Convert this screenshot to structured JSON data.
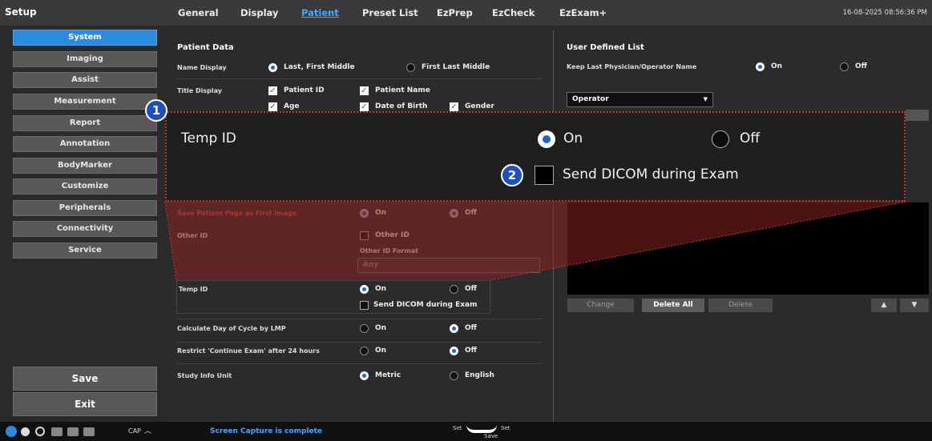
{
  "app": {
    "title": "Setup",
    "datetime": "16-08-2025 08:56:36 PM"
  },
  "tabs": [
    {
      "label": "General"
    },
    {
      "label": "Display"
    },
    {
      "label": "Patient"
    },
    {
      "label": "Preset List"
    },
    {
      "label": "EzPrep"
    },
    {
      "label": "EzCheck"
    },
    {
      "label": "EzExam+"
    }
  ],
  "sidebar": {
    "items": [
      {
        "label": "System"
      },
      {
        "label": "Imaging"
      },
      {
        "label": "Assist"
      },
      {
        "label": "Measurement"
      },
      {
        "label": "Report"
      },
      {
        "label": "Annotation"
      },
      {
        "label": "BodyMarker"
      },
      {
        "label": "Customize"
      },
      {
        "label": "Peripherals"
      },
      {
        "label": "Connectivity"
      },
      {
        "label": "Service"
      }
    ],
    "save": "Save",
    "exit": "Exit"
  },
  "patient": {
    "section": "Patient Data",
    "name_display": {
      "label": "Name Display",
      "opt1": "Last, First Middle",
      "opt2": "First Last Middle"
    },
    "title_display": {
      "label": "Title Display",
      "patient_id": "Patient ID",
      "patient_name": "Patient Name",
      "age": "Age",
      "dob": "Date of Birth",
      "gender": "Gender"
    },
    "save_page": {
      "label": "Save Patient Page as First Image",
      "on": "On",
      "off": "Off"
    },
    "other_id": {
      "label": "Other ID",
      "check": "Other ID",
      "format_label": "Other ID Format",
      "format_value": "Any"
    },
    "temp_id": {
      "label": "Temp ID",
      "on": "On",
      "off": "Off",
      "send_dicom": "Send DICOM during Exam"
    },
    "calc_cycle": {
      "label": "Calculate Day of Cycle by LMP",
      "on": "On",
      "off": "Off"
    },
    "restrict": {
      "label": "Restrict 'Continue Exam' after 24 hours",
      "on": "On",
      "off": "Off"
    },
    "study_unit": {
      "label": "Study Info Unit",
      "opt1": "Metric",
      "opt2": "English"
    }
  },
  "zoom": {
    "title": "Temp ID",
    "on": "On",
    "off": "Off",
    "send_dicom": "Send DICOM during Exam",
    "badge1": "1",
    "badge2": "2"
  },
  "user_list": {
    "section": "User Defined List",
    "keep_label": "Keep Last Physician/Operator Name",
    "on": "On",
    "off": "Off",
    "dropdown": "Operator",
    "buttons": {
      "change": "Change",
      "delete_all": "Delete All",
      "delete": "Delete"
    }
  },
  "statusbar": {
    "caps": "CAP",
    "capture_msg": "Screen Capture is complete",
    "set_left": "Set",
    "set_right": "Set",
    "save": "Save"
  },
  "colors": {
    "accent": "#2a8be0",
    "callout": "#c0392b",
    "badge": "#1b4fc4"
  }
}
